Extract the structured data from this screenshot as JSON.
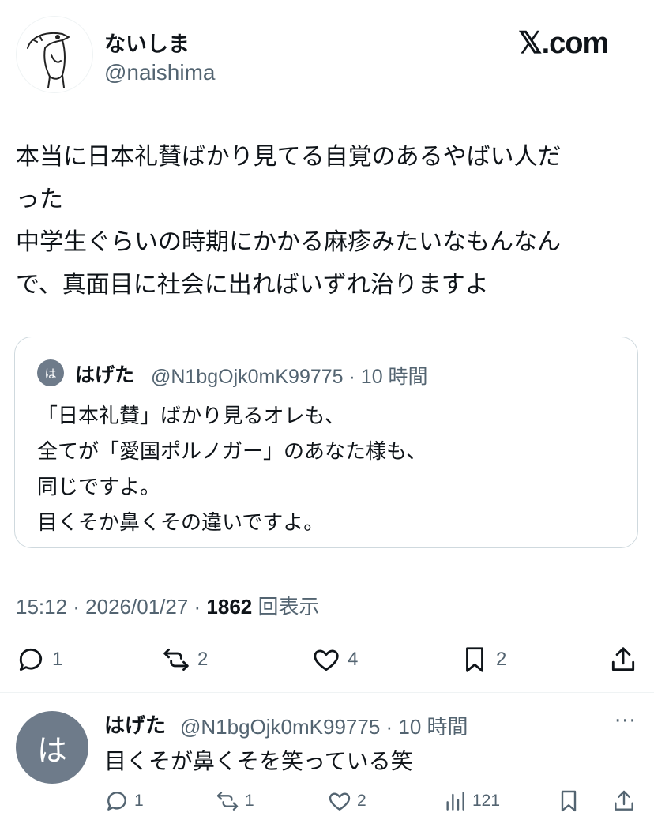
{
  "header": {
    "display_name": "ないしま",
    "handle": "@naishima",
    "site_logo": "𝕏.com"
  },
  "tweet": {
    "lines": [
      "本当に日本礼賛ばかり見てる自覚のあるやばい人だ",
      "った",
      "中学生ぐらいの時期にかかる麻疹みたいなもんなん",
      "で、真面目に社会に出ればいずれ治りますよ"
    ],
    "time": "15:12 · 2026/01/27 · ",
    "views_count": "1862",
    "views_label": "回表示"
  },
  "quote": {
    "avatar_char": "は",
    "name": "はげた",
    "meta": "@N1bgOjk0mK99775 · 10 時間",
    "lines": [
      "「日本礼賛」ばかり見るオレも、",
      "全てが「愛国ポルノガー」のあなた様も、",
      "同じですよ。",
      "目くそか鼻くその違いですよ。"
    ]
  },
  "actions": {
    "replies": "1",
    "reposts": "2",
    "likes": "4",
    "bookmarks": "2"
  },
  "reply": {
    "avatar_char": "は",
    "name": "はげた",
    "meta": "@N1bgOjk0mK99775 · 10 時間",
    "more": "···",
    "text": "目くそが鼻くそを笑っている笑",
    "actions": {
      "replies": "1",
      "reposts": "1",
      "likes": "2",
      "views": "121"
    }
  },
  "colors": {
    "text": "#0f1419",
    "secondary": "#536471",
    "border": "#cfd9de",
    "avatar_gray": "#6e7b8a"
  }
}
